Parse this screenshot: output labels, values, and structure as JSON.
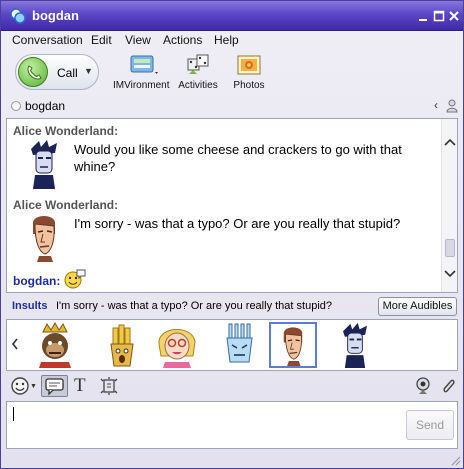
{
  "window": {
    "title": "bogdan"
  },
  "menu": [
    "Conversation",
    "Edit",
    "View",
    "Actions",
    "Help"
  ],
  "toolbar": {
    "call_label": "Call",
    "items": [
      {
        "label": "IMVironment",
        "icon": "imvironment-icon"
      },
      {
        "label": "Activities",
        "icon": "activities-icon"
      },
      {
        "label": "Photos",
        "icon": "photos-icon"
      }
    ]
  },
  "contact": {
    "name": "bogdan",
    "status_icon": "offline-status-icon"
  },
  "messages": [
    {
      "sender": "Alice Wonderland:",
      "text": "Would you like some cheese and crackers to go with that whine?",
      "avatar": "goth-boy-avatar"
    },
    {
      "sender": "Alice Wonderland:",
      "text": "I'm sorry - was that a typo? Or are you really that stupid?",
      "avatar": "sneering-man-avatar"
    }
  ],
  "my_line": {
    "sender": "bogdan:",
    "emoticon": "audible-emoticon-icon"
  },
  "audibles": {
    "category": "Insults",
    "current_text": "I'm sorry - was that a typo? Or are you really that stupid?",
    "more_label": "More Audibles",
    "items": [
      {
        "name": "gorilla-king-audible"
      },
      {
        "name": "french-fries-audible"
      },
      {
        "name": "blonde-woman-audible"
      },
      {
        "name": "angry-fork-audible"
      },
      {
        "name": "sneering-man-audible",
        "selected": true
      },
      {
        "name": "goth-boy-audible"
      }
    ]
  },
  "input": {
    "value": "",
    "send_label": "Send"
  },
  "colors": {
    "title_bar": "#5b46c7",
    "sender_name": "#555555",
    "my_name": "#1e2d9a",
    "accent_blue": "#5a7ddc"
  }
}
